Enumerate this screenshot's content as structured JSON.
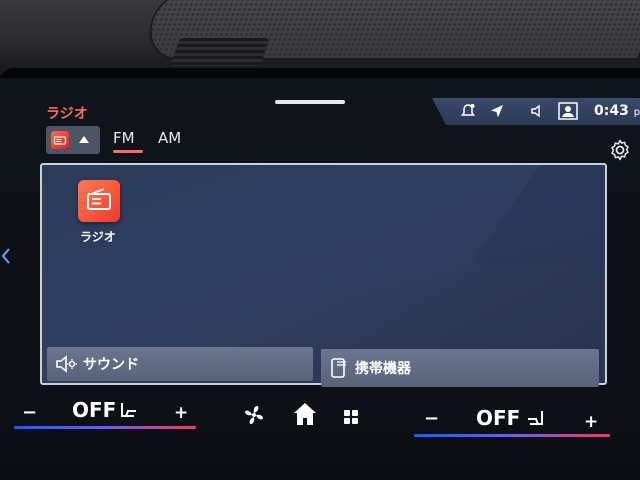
{
  "header": {
    "app_title": "ラジオ",
    "status_bar": {
      "time": "0:43",
      "time_suffix": "pm",
      "icons": [
        "bell-icon",
        "navigation-arrow-icon",
        "speaker-icon",
        "profile-icon"
      ]
    }
  },
  "source_selector": {
    "icon": "radio-icon",
    "caret": "caret-up-icon"
  },
  "tabs": [
    {
      "label": "FM",
      "active": true
    },
    {
      "label": "AM",
      "active": false
    }
  ],
  "content": {
    "app_tile_label": "ラジオ",
    "bottom_buttons": [
      {
        "label": "サウンド",
        "icon": "sound-settings-icon"
      },
      {
        "label": "携帯機器",
        "icon": "mobile-device-icon"
      }
    ]
  },
  "climate": {
    "left": {
      "minus": "−",
      "value": "OFF",
      "plus": "+",
      "icon": "seat-heater-icon"
    },
    "right": {
      "minus": "−",
      "value": "OFF",
      "plus": "+",
      "icon": "seat-heater-icon"
    },
    "center_icons": [
      "fan-icon",
      "home-icon",
      "apps-grid-icon"
    ]
  },
  "colors": {
    "accent": "#ff6a5a",
    "panel": "#2f3f60",
    "button": "#636d86"
  }
}
